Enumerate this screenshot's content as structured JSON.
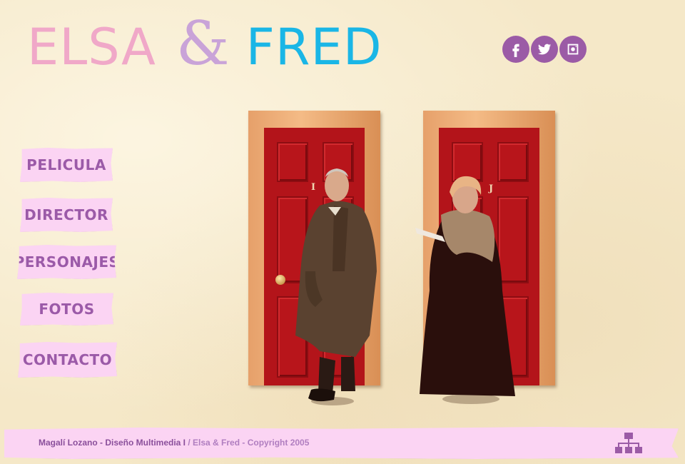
{
  "header": {
    "logo_part1": "ELSA",
    "logo_amp": "&",
    "logo_part2": "FRED",
    "colors": {
      "elsa": "#f0a8c8",
      "amp": "#c9a3d8",
      "fred": "#1ab6e6"
    }
  },
  "social": [
    {
      "icon": "facebook-icon"
    },
    {
      "icon": "twitter-icon"
    },
    {
      "icon": "instagram-icon"
    }
  ],
  "nav": {
    "items": [
      {
        "label": "PELICULA"
      },
      {
        "label": "DIRECTOR"
      },
      {
        "label": "PERSONAJES"
      },
      {
        "label": "FOTOS"
      },
      {
        "label": "CONTACTO"
      }
    ]
  },
  "scene": {
    "door_left_letter": "I",
    "door_right_letter": "J"
  },
  "footer": {
    "author": "Magalí Lozano - Diseño Multimedia I",
    "separator": " / ",
    "copyright": "Elsa & Fred - Copyright 2005",
    "sitemap_icon": "sitemap-icon"
  },
  "accent_colors": {
    "purple": "#9b5ba6",
    "pink_tab": "#fbd4f3",
    "tab_text": "#9b5aa8",
    "door_red": "#b3141a"
  }
}
